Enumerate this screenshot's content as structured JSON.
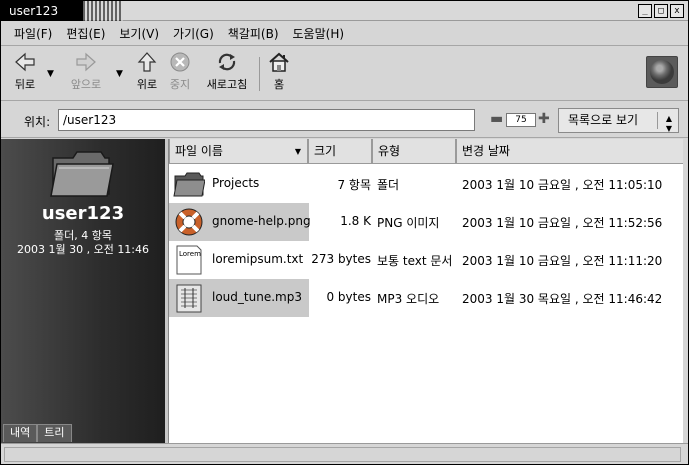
{
  "window": {
    "title": "user123",
    "buttons": [
      "_",
      "□",
      "x"
    ]
  },
  "menu": [
    "파일(F)",
    "편집(E)",
    "보기(V)",
    "가기(G)",
    "책갈피(B)",
    "도움말(H)"
  ],
  "toolbar": {
    "back": "뒤로",
    "forward": "앞으로",
    "up": "위로",
    "stop": "중지",
    "reload": "새로고침",
    "home": "홈"
  },
  "location": {
    "label": "위치:",
    "value": "/user123",
    "zoom": "75",
    "view_mode": "목록으로 보기"
  },
  "sidepane": {
    "name": "user123",
    "info_line1": "폴더, 4 항목",
    "info_line2": "2003  1월 30 , 오전 11:46",
    "tabs": [
      "내역",
      "트리"
    ]
  },
  "columns": [
    "파일 이름",
    "크기",
    "유형",
    "변경 날짜"
  ],
  "files": [
    {
      "name": "Projects",
      "size": "7 항목",
      "type": "폴더",
      "date": "2003 1월 10 금요일 , 오전 11:05:10",
      "icon": "folder-icon"
    },
    {
      "name": "gnome-help.png",
      "size": "1.8 K",
      "type": "PNG 이미지",
      "date": "2003 1월 10 금요일 , 오전 11:52:56",
      "icon": "lifebuoy-icon"
    },
    {
      "name": "loremipsum.txt",
      "size": "273 bytes",
      "type": "보통 text 문서",
      "date": "2003 1월 10 금요일 , 오전 11:11:20",
      "icon": "text-document-icon",
      "icon_text": "Lorem"
    },
    {
      "name": "loud_tune.mp3",
      "size": "0 bytes",
      "type": "MP3 오디오",
      "date": "2003 1월 30 목요일 , 오전 11:46:42",
      "icon": "audio-file-icon"
    }
  ]
}
